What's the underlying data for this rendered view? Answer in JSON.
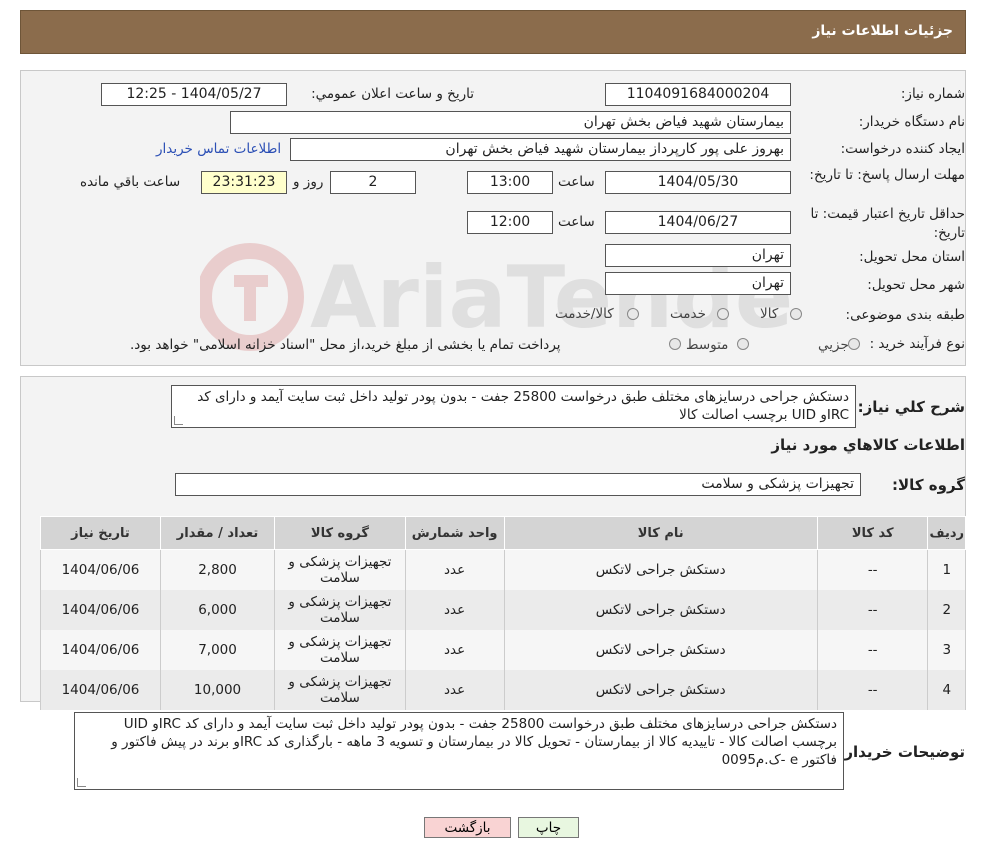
{
  "header": {
    "title": "جزئیات اطلاعات نیاز"
  },
  "info": {
    "need_number_label": "شماره نیاز:",
    "need_number": "1104091684000204",
    "announce_label": "تاریخ و ساعت اعلان عمومي:",
    "announce_value": "1404/05/27 - 12:25",
    "buyer_org_label": "نام دستگاه خريدار:",
    "buyer_org": "بيمارستان شهيد فياض بخش تهران",
    "creator_label": "ايجاد کننده درخواست:",
    "creator": "بهروز علی پور کارپرداز بيمارستان شهيد فياض بخش تهران",
    "contact_link": "اطلاعات تماس خريدار",
    "reply_deadline_label": "مهلت ارسال پاسخ: تا تاريخ:",
    "reply_date": "1404/05/30",
    "time_label": "ساعت",
    "reply_time": "13:00",
    "days_count": "2",
    "days_label": "روز و",
    "remaining_time": "23:31:23",
    "remaining_label": "ساعت باقي مانده",
    "price_validity_label": "حداقل تاريخ اعتبار قيمت: تا تاريخ:",
    "price_date": "1404/06/27",
    "price_time": "12:00",
    "province_label": "استان محل تحويل:",
    "province": "تهران",
    "city_label": "شهر محل تحويل:",
    "city": "تهران",
    "category_label": "طبقه بندی موضوعی:",
    "category_options": [
      "کالا",
      "خدمت",
      "کالا/خدمت"
    ],
    "process_label": "نوع فرآيند خريد :",
    "process_options": [
      "جزيي",
      "متوسط"
    ],
    "process_note": "پرداخت تمام يا بخشی از مبلغ خريد،از محل \"اسناد خزانه اسلامی\" خواهد بود."
  },
  "summary": {
    "desc_label": "شرح کلي نياز:",
    "desc_text": "دستکش جراحی درسایزهای مختلف طبق درخواست 25800 جفت - بدون پودر تولید داخل ثبت سایت آیمد و دارای کد IRCو UID برچسب اصالت کالا",
    "items_title": "اطلاعات کالاهاي مورد نياز",
    "group_label": "گروه کالا:",
    "group_value": "تجهيزات پزشکی و سلامت"
  },
  "table": {
    "headers": [
      "رديف",
      "کد کالا",
      "نام کالا",
      "واحد شمارش",
      "گروه کالا",
      "تعداد / مقدار",
      "تاريخ نياز"
    ],
    "rows": [
      [
        "1",
        "--",
        "دستکش جراحی لاتکس",
        "عدد",
        "تجهيزات پزشکی و سلامت",
        "2,800",
        "1404/06/06"
      ],
      [
        "2",
        "--",
        "دستکش جراحی لاتکس",
        "عدد",
        "تجهيزات پزشکی و سلامت",
        "6,000",
        "1404/06/06"
      ],
      [
        "3",
        "--",
        "دستکش جراحی لاتکس",
        "عدد",
        "تجهيزات پزشکی و سلامت",
        "7,000",
        "1404/06/06"
      ],
      [
        "4",
        "--",
        "دستکش جراحی لاتکس",
        "عدد",
        "تجهيزات پزشکی و سلامت",
        "10,000",
        "1404/06/06"
      ]
    ]
  },
  "buyer_notes": {
    "label": "توضيحات خريدار:",
    "text": "دستکش جراحی درسایزهای مختلف طبق درخواست 25800 جفت - بدون پودر تولید داخل ثبت سایت آیمد و دارای کد IRCو UID برچسب اصالت کالا - تاییدیه کالا از بیمارستان - تحویل کالا در بیمارستان و تسویه 3 ماهه - بارگذاری کد IRCو برند در پیش فاکتور و فاکتور e -ک.م0095"
  },
  "buttons": {
    "print": "چاپ",
    "back": "بازگشت"
  },
  "watermark": {
    "text": "AriaTender.neT"
  },
  "colors": {
    "header_bg": "#8b6c4c",
    "link": "#2b4fb5",
    "back_btn": "#f9d3d3",
    "print_btn": "#e8f7e0"
  }
}
